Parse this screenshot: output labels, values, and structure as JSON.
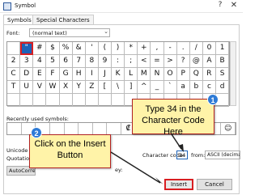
{
  "window": {
    "title": "Symbol",
    "help_icon": "?",
    "close_icon": "✕"
  },
  "tabs": [
    {
      "label": "Symbols"
    },
    {
      "label": "Special Characters"
    }
  ],
  "font": {
    "label": "Font:",
    "value": "(normal text)"
  },
  "grid": {
    "rows": [
      [
        " ",
        "\"",
        "#",
        "$",
        "%",
        "&",
        "'",
        "(",
        ")",
        "*",
        "+",
        ",",
        "-",
        ".",
        "/",
        "0",
        "1"
      ],
      [
        "2",
        "3",
        "4",
        "5",
        "6",
        "7",
        "8",
        "9",
        ":",
        ";",
        "<",
        "=",
        ">",
        "?",
        "@",
        "A",
        "B"
      ],
      [
        "C",
        "D",
        "E",
        "F",
        "G",
        "H",
        "I",
        "J",
        "K",
        "L",
        "M",
        "N",
        "O",
        "P",
        "Q",
        "R",
        "S"
      ],
      [
        "T",
        "U",
        "V",
        "W",
        "X",
        "Y",
        "Z",
        "[",
        "\\",
        "]",
        "^",
        "_",
        "`",
        "a",
        "b",
        "c",
        "d"
      ],
      [
        "",
        "",
        "",
        "",
        "",
        "",
        "",
        "",
        "",
        "",
        "",
        "",
        "",
        "",
        "",
        "",
        ""
      ]
    ],
    "selected_row": 0,
    "selected_col": 1
  },
  "recent": {
    "label": "Recently used symbols:",
    "symbols": [
      "",
      "",
      "",
      "",
      "",
      "",
      "",
      "",
      "₡",
      "¢",
      "",
      "",
      "",
      "",
      "",
      "☺"
    ]
  },
  "unicode_label": "Unicode name:",
  "quotation_label": "Quotation mark",
  "autocorrect_label": "AutoCorrect...",
  "shortcut_key_tail": "ey:",
  "character_code": {
    "label": "Character code:",
    "value": "34"
  },
  "from": {
    "label": "from:",
    "value": "ASCII (decimal)"
  },
  "buttons": {
    "insert": "Insert",
    "cancel": "Cancel"
  },
  "callouts": {
    "one": {
      "number": "1",
      "text": "Type 34 in the Character Code Here"
    },
    "two": {
      "number": "2",
      "text": "Click on the Insert Button"
    }
  },
  "colors": {
    "selection": "#1e63b8",
    "highlight_border": "#d81e22",
    "callout_fill": "#fff3a8",
    "badge": "#2e7bd6"
  }
}
